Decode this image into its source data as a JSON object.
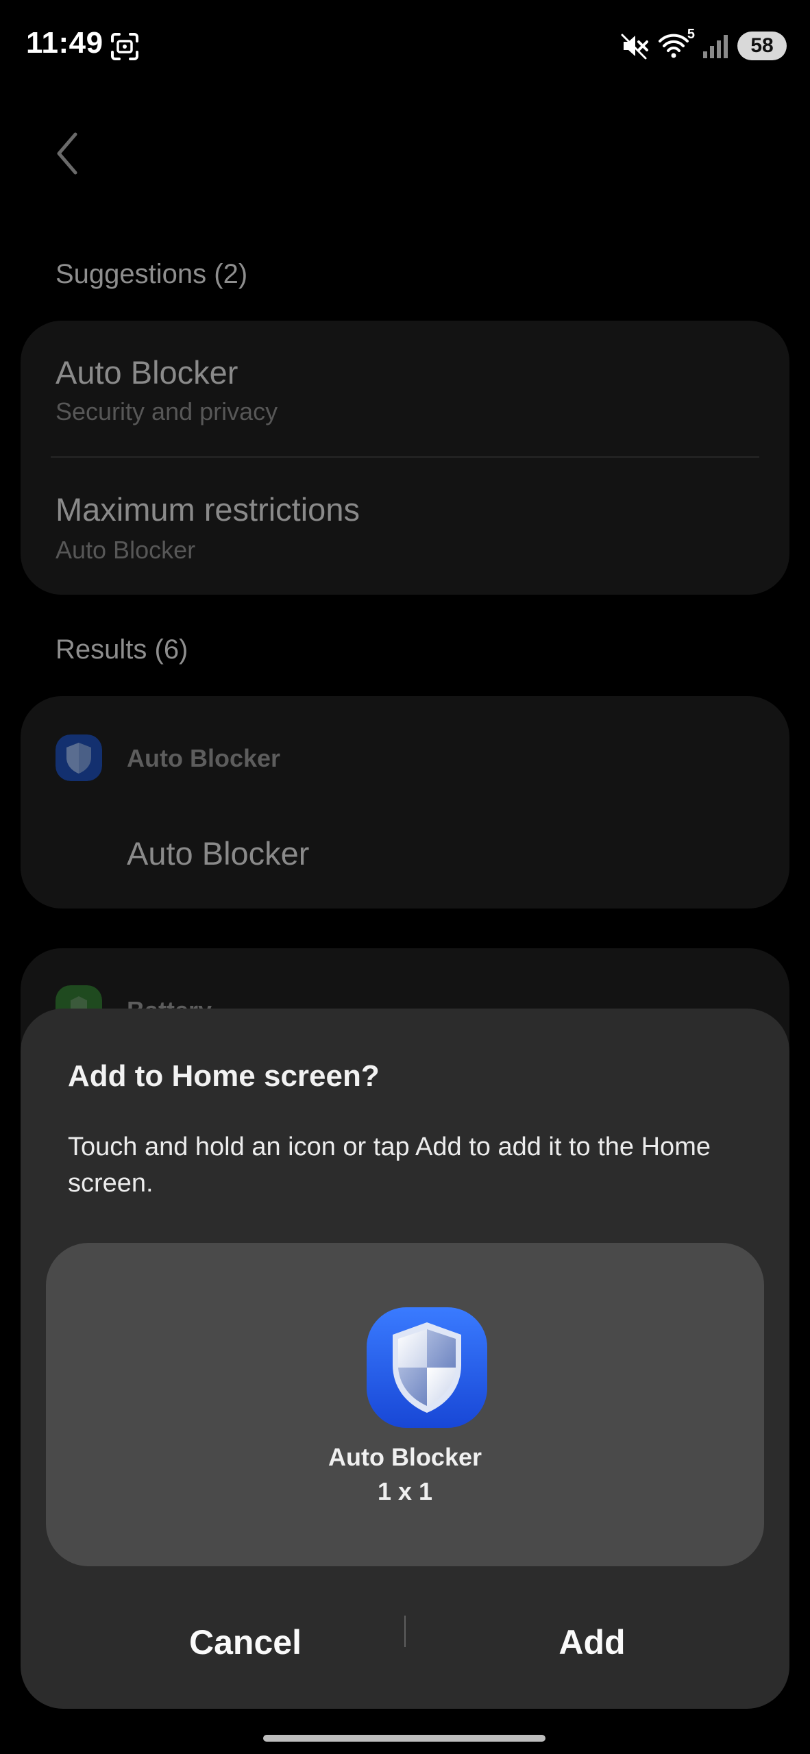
{
  "status_bar": {
    "time": "11:49",
    "battery_level": "58",
    "wifi_badge": "5",
    "icons": [
      "screenshot-icon",
      "mute-icon",
      "wifi-icon",
      "signal-icon",
      "battery-icon"
    ]
  },
  "background": {
    "back_icon": "chevron-left-icon",
    "suggestions_header": "Suggestions (2)",
    "suggestions": [
      {
        "title": "Auto Blocker",
        "subtitle": "Security and privacy"
      },
      {
        "title": "Maximum restrictions",
        "subtitle": "Auto Blocker"
      }
    ],
    "results_header": "Results (6)",
    "results": [
      {
        "app": "Auto Blocker",
        "item": "Auto Blocker",
        "icon": "shield-icon"
      },
      {
        "app": "Battery",
        "icon": "battery-app-icon"
      }
    ]
  },
  "dialog": {
    "title": "Add to Home screen?",
    "message": "Touch and hold an icon or tap Add to add it to the Home screen.",
    "widget": {
      "name": "Auto Blocker",
      "size": "1 x 1",
      "icon": "shield-icon"
    },
    "cancel_label": "Cancel",
    "add_label": "Add"
  },
  "colors": {
    "background": "#000000",
    "card": "#131313",
    "dialog": "#2c2c2c",
    "preview_panel": "#4a4a4a",
    "shield_blue": "#1f5de6"
  }
}
